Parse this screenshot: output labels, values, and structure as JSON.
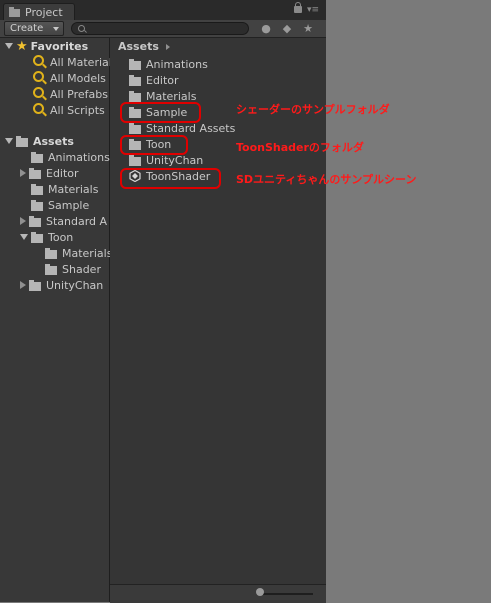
{
  "window": {
    "tab_title": "Project"
  },
  "toolbar": {
    "create_label": "Create",
    "search_value": "",
    "icons": [
      "search-icon",
      "filter-by-type-icon",
      "filter-by-label-icon",
      "favorite-star-icon"
    ]
  },
  "sidebar": {
    "favorites_label": "Favorites",
    "favorites": [
      {
        "label": "All Material"
      },
      {
        "label": "All Models"
      },
      {
        "label": "All Prefabs"
      },
      {
        "label": "All Scripts"
      }
    ],
    "assets_label": "Assets",
    "tree": [
      {
        "label": "Animations"
      },
      {
        "label": "Editor"
      },
      {
        "label": "Materials"
      },
      {
        "label": "Sample"
      },
      {
        "label": "Standard A"
      },
      {
        "label": "Toon"
      },
      {
        "label": "Materials"
      },
      {
        "label": "Shader"
      },
      {
        "label": "UnityChan"
      }
    ]
  },
  "main": {
    "breadcrumb": "Assets",
    "items": [
      {
        "label": "Animations",
        "type": "folder"
      },
      {
        "label": "Editor",
        "type": "folder"
      },
      {
        "label": "Materials",
        "type": "folder"
      },
      {
        "label": "Sample",
        "type": "folder"
      },
      {
        "label": "Standard Assets",
        "type": "folder"
      },
      {
        "label": "Toon",
        "type": "folder"
      },
      {
        "label": "UnityChan",
        "type": "folder"
      },
      {
        "label": "ToonShader",
        "type": "unity-scene"
      }
    ]
  },
  "annotations": {
    "color": "#ff1a1a",
    "sample_note": "シェーダーのサンプルフォルダ",
    "toon_note": "ToonShaderのフォルダ",
    "scene_note": "SDユニティちゃんのサンプルシーン"
  }
}
